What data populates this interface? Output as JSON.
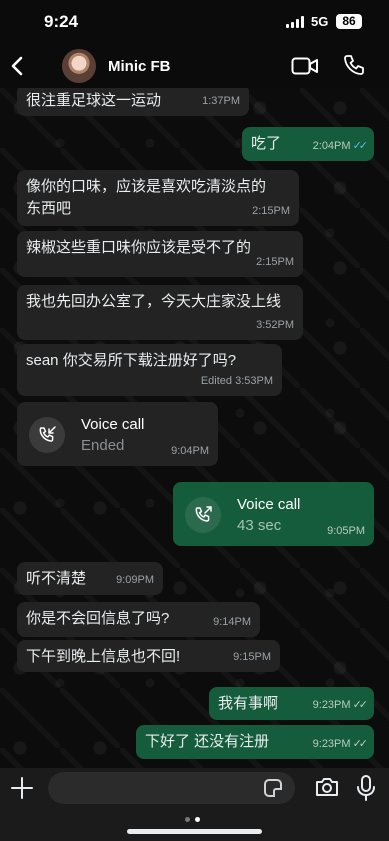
{
  "status_bar": {
    "time": "9:24",
    "network": "5G",
    "battery": "86"
  },
  "header": {
    "contact_name": "Minic FB"
  },
  "messages": [
    {
      "text": "很注重足球这一运动",
      "time": "1:37PM"
    },
    {
      "text": "吃了",
      "time": "2:04PM",
      "ticks": "✓✓"
    },
    {
      "text": "像你的口味，应该是喜欢吃清淡点的东西吧",
      "time": "2:15PM"
    },
    {
      "text": "辣椒这些重口味你应该是受不了的",
      "time": "2:15PM"
    },
    {
      "text": "我也先回办公室了，今天大庄家没上线",
      "time": "3:52PM"
    },
    {
      "text": "sean 你交易所下载注册好了吗?",
      "time": "Edited 3:53PM"
    },
    {
      "title": "Voice call",
      "subtitle": "Ended",
      "time": "9:04PM"
    },
    {
      "title": "Voice call",
      "subtitle": "43 sec",
      "time": "9:05PM"
    },
    {
      "text": "听不清楚",
      "time": "9:09PM"
    },
    {
      "text": "你是不会回信息了吗?",
      "time": "9:14PM"
    },
    {
      "text": "下午到晚上信息也不回!",
      "time": "9:15PM"
    },
    {
      "text": "我有事啊",
      "time": "9:23PM",
      "ticks": "✓✓"
    },
    {
      "text": "下好了 还没有注册",
      "time": "9:23PM",
      "ticks": "✓✓"
    }
  ],
  "composer": {
    "value": ""
  },
  "colors": {
    "incoming": "#232323",
    "outgoing": "#155c3c",
    "read_ticks": "#53bdeb"
  },
  "icons": [
    "back-chevron-icon",
    "video-call-icon",
    "phone-icon",
    "call-missed-icon",
    "call-outgoing-icon",
    "plus-icon",
    "sticker-icon",
    "camera-icon",
    "microphone-icon"
  ]
}
